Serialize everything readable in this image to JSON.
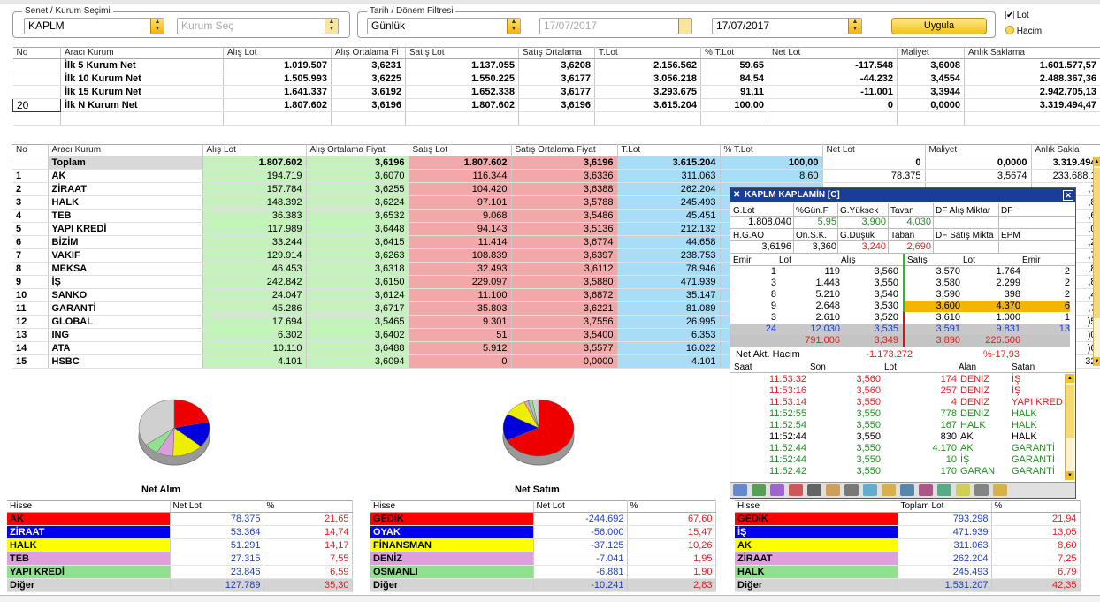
{
  "filters": {
    "stock_group_label": "Senet / Kurum Seçimi",
    "stock_value": "KAPLM",
    "broker_placeholder": "Kurum Seç",
    "period_group_label": "Tarih / Dönem Filtresi",
    "period_value": "Günlük",
    "date_from": "17/07/2017",
    "date_to": "17/07/2017",
    "apply_label": "Uygula",
    "opt_lot": "Lot",
    "opt_hacim": "Hacim"
  },
  "summary": {
    "headers": [
      "No",
      "Aracı Kurum",
      "Alış Lot",
      "Alış Ortalama Fi",
      "Satış Lot",
      "Satış Ortalama",
      "T.Lot",
      "% T.Lot",
      "Net Lot",
      "Maliyet",
      "Anlık Saklama"
    ],
    "rows": [
      [
        "",
        "İlk 5 Kurum Net",
        "1.019.507",
        "3,6231",
        "1.137.055",
        "3,6208",
        "2.156.562",
        "59,65",
        "-117.548",
        "3,6008",
        "1.601.577,57"
      ],
      [
        "",
        "İlk 10 Kurum Net",
        "1.505.993",
        "3,6225",
        "1.550.225",
        "3,6177",
        "3.056.218",
        "84,54",
        "-44.232",
        "3,4554",
        "2.488.367,36"
      ],
      [
        "",
        "İlk 15 Kurum Net",
        "1.641.337",
        "3,6192",
        "1.652.338",
        "3,6177",
        "3.293.675",
        "91,11",
        "-11.001",
        "3,3944",
        "2.942.705,13"
      ],
      [
        "20",
        "İlk N Kurum Net",
        "1.807.602",
        "3,6196",
        "1.807.602",
        "3,6196",
        "3.615.204",
        "100,00",
        "0",
        "0,0000",
        "3.319.494,47"
      ]
    ]
  },
  "brokers": {
    "headers": [
      "No",
      "Aracı Kurum",
      "Alış Lot",
      "Alış Ortalama Fiyat",
      "Satış Lot",
      "Satış Ortalama Fiyat",
      "T.Lot",
      "% T.Lot",
      "Net Lot",
      "Maliyet",
      "Anlık Sakla"
    ],
    "total": [
      "",
      "Toplam",
      "1.807.602",
      "3,6196",
      "1.807.602",
      "3,6196",
      "3.615.204",
      "100,00",
      "0",
      "0,0000",
      "3.319.494"
    ],
    "rows": [
      [
        "1",
        "AK",
        "194.719",
        "3,6070",
        "116.344",
        "3,6336",
        "311.063",
        "8,60",
        "78.375",
        "3,5674",
        "233.688,1"
      ],
      [
        "2",
        "ZİRAAT",
        "157.784",
        "3,6255",
        "104.420",
        "3,6388",
        "262.204",
        "",
        "",
        "",
        ",7"
      ],
      [
        "3",
        "HALK",
        "148.392",
        "3,6224",
        "97.101",
        "3,5788",
        "245.493",
        "",
        "",
        "",
        ",8"
      ],
      [
        "4",
        "TEB",
        "36.383",
        "3,6532",
        "9.068",
        "3,5486",
        "45.451",
        "",
        "",
        "",
        ",6"
      ],
      [
        "5",
        "YAPI KREDİ",
        "117.989",
        "3,6448",
        "94.143",
        "3,5136",
        "212.132",
        "",
        "",
        "",
        ",0"
      ],
      [
        "6",
        "BİZİM",
        "33.244",
        "3,6415",
        "11.414",
        "3,6774",
        "44.658",
        "",
        "",
        "",
        ",2"
      ],
      [
        "7",
        "VAKIF",
        "129.914",
        "3,6263",
        "108.839",
        "3,6397",
        "238.753",
        "",
        "",
        "",
        ",7"
      ],
      [
        "8",
        "MEKSA",
        "46.453",
        "3,6318",
        "32.493",
        "3,6112",
        "78.946",
        "",
        "",
        "",
        ",8"
      ],
      [
        "9",
        "İŞ",
        "242.842",
        "3,6150",
        "229.097",
        "3,5880",
        "471.939",
        "",
        "",
        "",
        ",8"
      ],
      [
        "10",
        "SANKO",
        "24.047",
        "3,6124",
        "11.100",
        "3,6872",
        "35.147",
        "",
        "",
        "",
        ",4"
      ],
      [
        "11",
        "GARANTİ",
        "45.286",
        "3,6717",
        "35.803",
        "3,6221",
        "81.089",
        "",
        "",
        "",
        ",7"
      ],
      [
        "12",
        "GLOBAL",
        "17.694",
        "3,5465",
        "9.301",
        "3,7556",
        "26.995",
        "",
        "",
        "",
        ")5"
      ],
      [
        "13",
        "ING",
        "6.302",
        "3,6402",
        "51",
        "3,5400",
        "6.353",
        "",
        "",
        "",
        ")0"
      ],
      [
        "14",
        "ATA",
        "10.110",
        "3,6488",
        "5.912",
        "3,5577",
        "16.022",
        "",
        "",
        "",
        ")6"
      ],
      [
        "15",
        "HSBC",
        "4.101",
        "3,6094",
        "0",
        "0,0000",
        "4.101",
        "",
        "",
        "",
        "32"
      ]
    ]
  },
  "depth": {
    "title": "KAPLM KAPLAMİN [C]",
    "info_headers1": [
      "G.Lot",
      "%Gün.F",
      "G.Yüksek",
      "Tavan",
      "DF Alış Miktar",
      "DF"
    ],
    "info_values1": [
      "1.808.040",
      "5,95",
      "3,900",
      "4,030",
      "",
      ""
    ],
    "info_headers2": [
      "H.G.AO",
      "On.S.K.",
      "G.Düşük",
      "Taban",
      "DF Satış Mikta",
      "EPM"
    ],
    "info_values2": [
      "3,6196",
      "3,360",
      "3,240",
      "2,690",
      "",
      ""
    ],
    "book_headers": [
      "Emir",
      "Lot",
      "Alış",
      "Satış",
      "Lot",
      "Emir"
    ],
    "book": [
      [
        "1",
        "119",
        "3,560",
        "3,570",
        "1.764",
        "2"
      ],
      [
        "3",
        "1.443",
        "3,550",
        "3,580",
        "2.299",
        "2"
      ],
      [
        "8",
        "5.210",
        "3,540",
        "3,590",
        "398",
        "2"
      ],
      [
        "9",
        "2.648",
        "3,530",
        "3,600",
        "4.370",
        "6"
      ],
      [
        "3",
        "2.610",
        "3,520",
        "3,610",
        "1.000",
        "1"
      ]
    ],
    "book_sum": [
      "24",
      "12.030",
      "3,535",
      "3,591",
      "9.831",
      "13"
    ],
    "book_total": [
      "",
      "791.006",
      "3,349",
      "3,890",
      "226.506",
      ""
    ],
    "net_label": "Net Akt. Hacim",
    "net_value": "-1.173.272",
    "net_pct": "%-17,93",
    "trade_headers": [
      "Saat",
      "Son",
      "Lot",
      "Alan",
      "Satan"
    ],
    "trades": [
      [
        "11:53:32",
        "3,560",
        "174",
        "DENİZ",
        "İŞ",
        "red"
      ],
      [
        "11:53:16",
        "3,560",
        "257",
        "DENİZ",
        "İŞ",
        "red"
      ],
      [
        "11:53:14",
        "3,550",
        "4",
        "DENİZ",
        "YAPI KRED",
        "red"
      ],
      [
        "11:52:55",
        "3,550",
        "778",
        "DENİZ",
        "HALK",
        "green"
      ],
      [
        "11:52:54",
        "3,550",
        "167",
        "HALK",
        "HALK",
        "green"
      ],
      [
        "11:52:44",
        "3,550",
        "830",
        "AK",
        "HALK",
        "black"
      ],
      [
        "11:52:44",
        "3,550",
        "4.170",
        "AK",
        "GARANTİ",
        "green"
      ],
      [
        "11:52:44",
        "3,550",
        "10",
        "İŞ",
        "GARANTİ",
        "green"
      ],
      [
        "11:52:42",
        "3,550",
        "170",
        "GARAN",
        "GARANTİ",
        "green"
      ]
    ]
  },
  "charts": {
    "net_alim_title": "Net Alım",
    "net_satim_title": "Net Satım"
  },
  "chart_data": [
    {
      "type": "pie",
      "title": "Net Alım",
      "categories": [
        "AK",
        "ZİRAAT",
        "HALK",
        "TEB",
        "YAPI KREDİ",
        "Diğer"
      ],
      "values": [
        21.65,
        14.74,
        14.17,
        7.55,
        6.59,
        35.3
      ],
      "colors": [
        "#ee0000",
        "#0000dd",
        "#eeee00",
        "#d8a0d8",
        "#90e090",
        "#d0d0d0"
      ]
    },
    {
      "type": "pie",
      "title": "Net Satım",
      "categories": [
        "GEDİK",
        "OYAK",
        "FİNANSMAN",
        "DENİZ",
        "OSMANLI",
        "Diğer"
      ],
      "values": [
        67.6,
        15.47,
        10.26,
        1.95,
        1.9,
        2.83
      ],
      "colors": [
        "#ee0000",
        "#0000dd",
        "#eeee00",
        "#d8a0d8",
        "#90e090",
        "#d0d0d0"
      ]
    }
  ],
  "bottom_tables": {
    "alim": {
      "headers": [
        "Hisse",
        "Net Lot",
        "%"
      ],
      "rows": [
        [
          "AK",
          "78.375",
          "21,65",
          "#ff0000"
        ],
        [
          "ZİRAAT",
          "53.364",
          "14,74",
          "#0000ee"
        ],
        [
          "HALK",
          "51.291",
          "14,17",
          "#ffff00"
        ],
        [
          "TEB",
          "27.315",
          "7,55",
          "#dda0dd"
        ],
        [
          "YAPI KREDİ",
          "23.846",
          "6,59",
          "#90e090"
        ],
        [
          "Diğer",
          "127.789",
          "35,30",
          "#d4d4d4"
        ]
      ]
    },
    "satim": {
      "headers": [
        "Hisse",
        "Net Lot",
        "%"
      ],
      "rows": [
        [
          "GEDİK",
          "-244.692",
          "67,60",
          "#ff0000"
        ],
        [
          "OYAK",
          "-56.000",
          "15,47",
          "#0000ee"
        ],
        [
          "FİNANSMAN",
          "-37.125",
          "10,26",
          "#ffff00"
        ],
        [
          "DENİZ",
          "-7.041",
          "1,95",
          "#dda0dd"
        ],
        [
          "OSMANLI",
          "-6.881",
          "1,90",
          "#90e090"
        ],
        [
          "Diğer",
          "-10.241",
          "2,83",
          "#d4d4d4"
        ]
      ]
    },
    "toplam": {
      "headers": [
        "Hisse",
        "Toplam Lot",
        "%"
      ],
      "rows": [
        [
          "GEDİK",
          "793.298",
          "21,94",
          "#ff0000"
        ],
        [
          "İŞ",
          "471.939",
          "13,05",
          "#0000ee"
        ],
        [
          "AK",
          "311.063",
          "8,60",
          "#ffff00"
        ],
        [
          "ZİRAAT",
          "262.204",
          "7,25",
          "#dda0dd"
        ],
        [
          "HALK",
          "245.493",
          "6,79",
          "#90e090"
        ],
        [
          "Diğer",
          "1.531.207",
          "42,35",
          "#d4d4d4"
        ]
      ]
    }
  }
}
